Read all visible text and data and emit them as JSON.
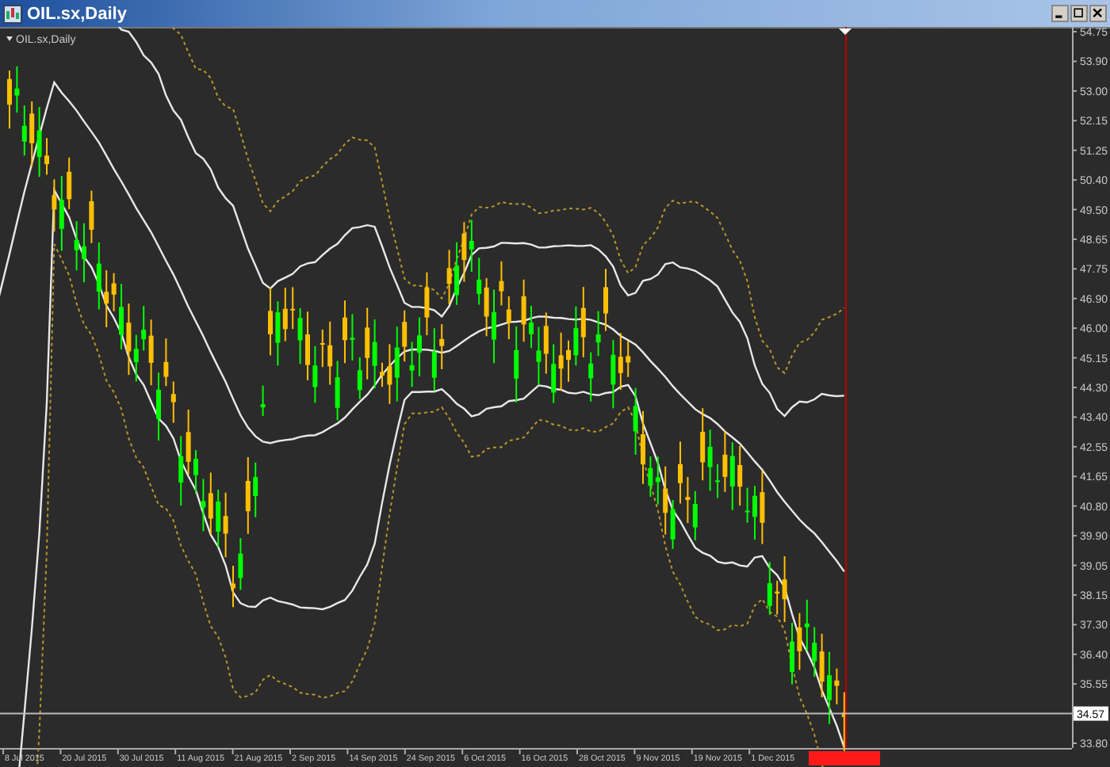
{
  "window": {
    "title": "OIL.sx,Daily"
  },
  "chart": {
    "symbol_label": "OIL.sx,Daily"
  },
  "price_axis": {
    "labels": [
      {
        "kind": "tick",
        "text": "54.75"
      },
      {
        "kind": "tick",
        "text": "53.90"
      },
      {
        "kind": "tick",
        "text": "53.00"
      },
      {
        "kind": "tick",
        "text": "52.15"
      },
      {
        "kind": "tick",
        "text": "51.25"
      },
      {
        "kind": "tick",
        "text": "50.40"
      },
      {
        "kind": "tick",
        "text": "49.50"
      },
      {
        "kind": "tick",
        "text": "48.65"
      },
      {
        "kind": "tick",
        "text": "47.75"
      },
      {
        "kind": "tick",
        "text": "46.90"
      },
      {
        "kind": "tick",
        "text": "46.00"
      },
      {
        "kind": "tick",
        "text": "45.15"
      },
      {
        "kind": "tick",
        "text": "44.30"
      },
      {
        "kind": "tick",
        "text": "43.40"
      },
      {
        "kind": "tick",
        "text": "42.55"
      },
      {
        "kind": "tick",
        "text": "41.65"
      },
      {
        "kind": "tick",
        "text": "40.80"
      },
      {
        "kind": "tick",
        "text": "39.90"
      },
      {
        "kind": "tick",
        "text": "39.05"
      },
      {
        "kind": "tick",
        "text": "38.15"
      },
      {
        "kind": "tick",
        "text": "37.30"
      },
      {
        "kind": "tick",
        "text": "36.40"
      },
      {
        "kind": "tick",
        "text": "35.55"
      },
      {
        "kind": "current",
        "text": "34.57"
      },
      {
        "kind": "tick",
        "text": "33.80"
      }
    ]
  },
  "time_axis": {
    "labels": [
      "8 Jul 2015",
      "20 Jul 2015",
      "30 Jul 2015",
      "11 Aug 2015",
      "21 Aug 2015",
      "2 Sep 2015",
      "14 Sep 2015",
      "24 Sep 2015",
      "6 Oct 2015",
      "16 Oct 2015",
      "28 Oct 2015",
      "9 Nov 2015",
      "19 Nov 2015",
      "1 Dec 2015"
    ]
  }
}
